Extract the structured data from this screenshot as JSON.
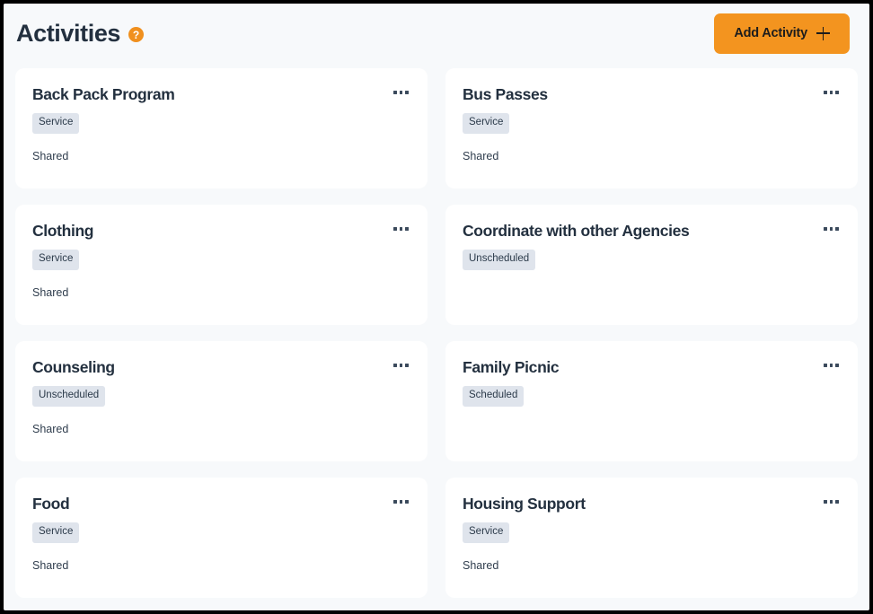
{
  "header": {
    "title": "Activities",
    "help_icon": "help-circle-icon",
    "help_glyph": "?",
    "add_button": {
      "label": "Add Activity",
      "icon": "plus-icon",
      "background_color": "#f3941f",
      "text_color": "#1c1c1c"
    }
  },
  "theme": {
    "page_background": "#f7f9fb",
    "card_background": "#ffffff",
    "title_color": "#23303f",
    "badge_background": "#dfe4ec",
    "badge_text": "#2b3a4a",
    "accent_orange": "#f3941f"
  },
  "menu_icon_name": "ellipsis-horizontal-icon",
  "cards": [
    {
      "title": "Back Pack Program",
      "badge": "Service",
      "shared": "Shared",
      "has_shared": true
    },
    {
      "title": "Bus Passes",
      "badge": "Service",
      "shared": "Shared",
      "has_shared": true
    },
    {
      "title": "Clothing",
      "badge": "Service",
      "shared": "Shared",
      "has_shared": true
    },
    {
      "title": "Coordinate with other Agencies",
      "badge": "Unscheduled",
      "shared": "",
      "has_shared": false
    },
    {
      "title": "Counseling",
      "badge": "Unscheduled",
      "shared": "Shared",
      "has_shared": true
    },
    {
      "title": "Family Picnic",
      "badge": "Scheduled",
      "shared": "",
      "has_shared": false
    },
    {
      "title": "Food",
      "badge": "Service",
      "shared": "Shared",
      "has_shared": true
    },
    {
      "title": "Housing Support",
      "badge": "Service",
      "shared": "Shared",
      "has_shared": true
    }
  ]
}
